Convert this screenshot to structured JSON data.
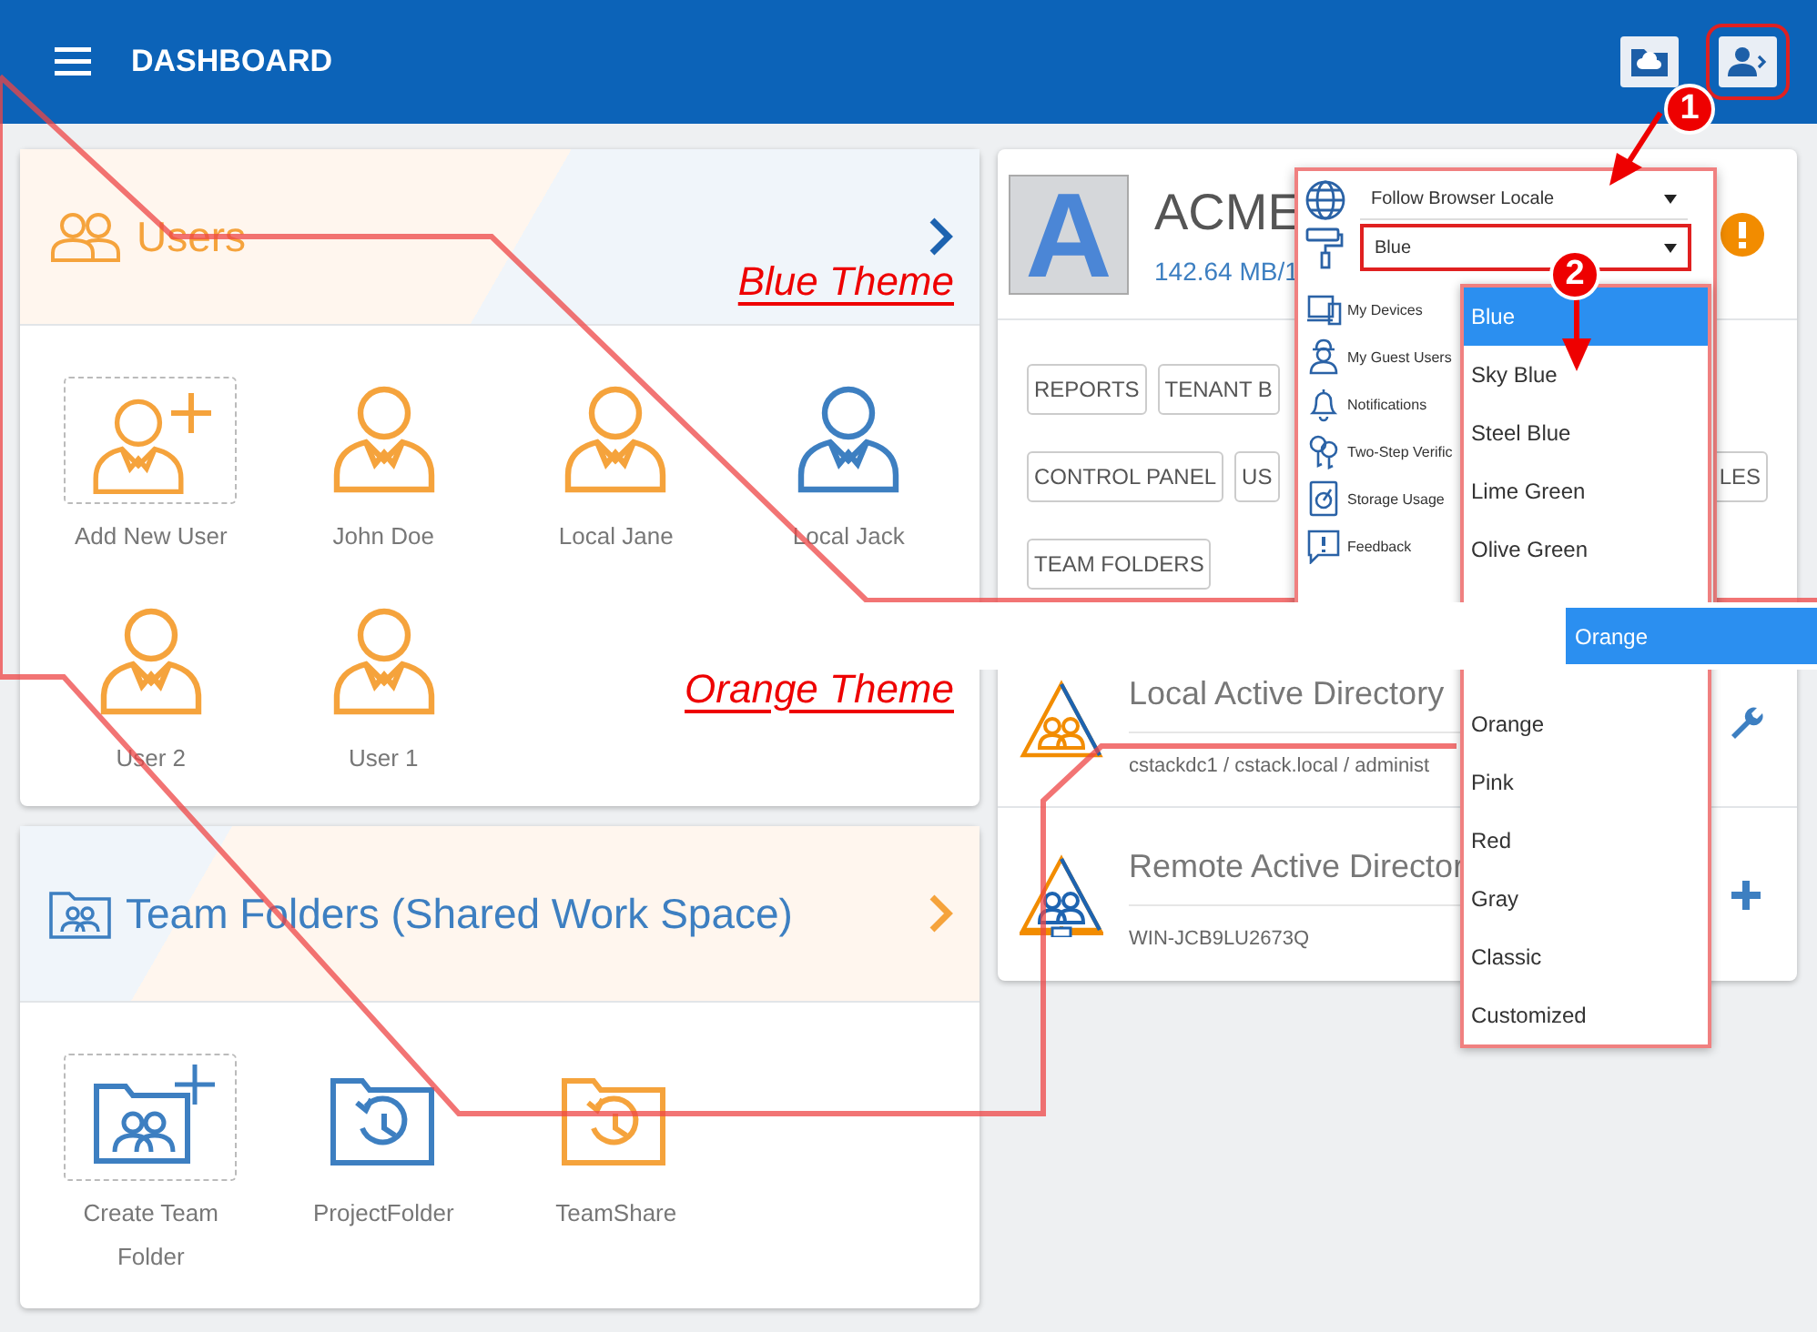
{
  "header": {
    "title": "DASHBOARD"
  },
  "users_card": {
    "title": "Users",
    "annotations": [
      "Blue Theme",
      "Orange Theme"
    ],
    "users": [
      {
        "name": "Add New User",
        "kind": "add",
        "color": "#f5a33c"
      },
      {
        "name": "John Doe",
        "kind": "user",
        "color": "#f5a33c"
      },
      {
        "name": "Local Jane",
        "kind": "user",
        "color": "#f5a33c"
      },
      {
        "name": "Local Jack",
        "kind": "user",
        "color": "#3d7fc1"
      },
      {
        "name": "User 2",
        "kind": "user",
        "color": "#f5a33c"
      },
      {
        "name": "User 1",
        "kind": "user",
        "color": "#f5a33c"
      }
    ]
  },
  "team_folders_card": {
    "title": "Team Folders (Shared Work Space)",
    "folders": [
      {
        "name": "Create Team Folder",
        "kind": "add",
        "color": "#3d7fc1"
      },
      {
        "name": "ProjectFolder",
        "kind": "folder",
        "color": "#3d7fc1"
      },
      {
        "name": "TeamShare",
        "kind": "folder",
        "color": "#f5a33c"
      }
    ]
  },
  "tenant_card": {
    "logo": "A",
    "name": "ACME",
    "storage": "142.64 MB/1",
    "button_rows": [
      [
        "REPORTS",
        "TENANT B"
      ],
      [
        "CONTROL PANEL",
        "US"
      ],
      [
        "TEAM FOLDERS"
      ]
    ],
    "cut_button": "LES"
  },
  "directories": [
    {
      "title": "Local Active Directory",
      "detail": "cstackdc1 / cstack.local / administ",
      "kind": "local"
    },
    {
      "title": "Remote Active Director",
      "detail": "WIN-JCB9LU2673Q",
      "kind": "remote"
    }
  ],
  "user_menu": {
    "language": "Follow Browser Locale",
    "theme": "Blue",
    "items": [
      {
        "label": "My Devices",
        "kind": "devices"
      },
      {
        "label": "My Guest Users",
        "kind": "guest"
      },
      {
        "label": "Notifications",
        "kind": "bell"
      },
      {
        "label": "Two-Step Verific",
        "kind": "keys"
      },
      {
        "label": "Storage Usage",
        "kind": "disk"
      },
      {
        "label": "Feedback",
        "kind": "feedback"
      }
    ]
  },
  "theme_list": {
    "options": [
      {
        "label": "Blue",
        "selected": true
      },
      {
        "label": "Sky Blue",
        "selected": false
      },
      {
        "label": "Steel Blue",
        "selected": false
      },
      {
        "label": "Lime Green",
        "selected": false
      },
      {
        "label": "Olive Green",
        "selected": false
      },
      {
        "label": "Orange",
        "selected": false
      },
      {
        "label": "Pink",
        "selected": false
      },
      {
        "label": "Red",
        "selected": false
      },
      {
        "label": "Gray",
        "selected": false
      },
      {
        "label": "Classic",
        "selected": false
      },
      {
        "label": "Customized",
        "selected": false
      }
    ]
  },
  "orange_preview": {
    "label": "Orange",
    "selected": true
  },
  "callouts": [
    "1",
    "2"
  ]
}
